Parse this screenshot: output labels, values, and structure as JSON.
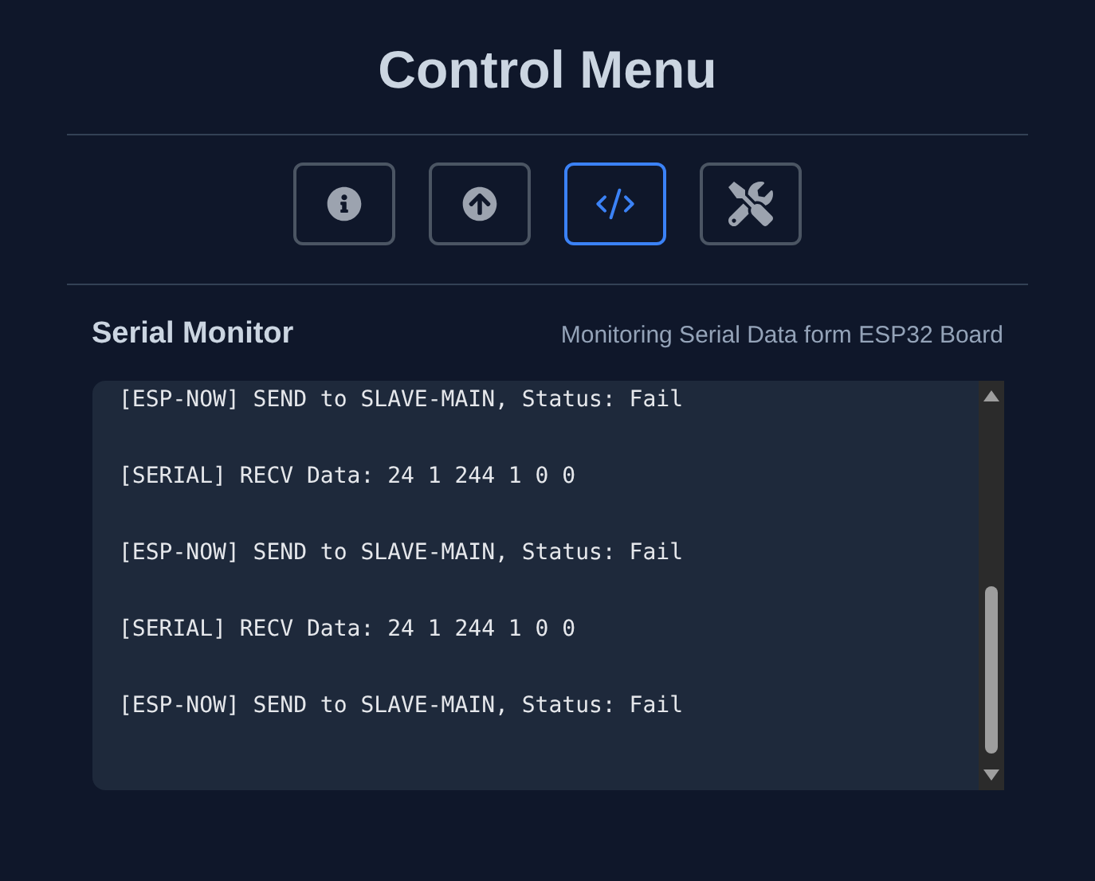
{
  "title": "Control Menu",
  "tabs": [
    {
      "kind": "info",
      "selected": false
    },
    {
      "kind": "upload",
      "selected": false
    },
    {
      "kind": "code",
      "selected": true
    },
    {
      "kind": "tools",
      "selected": false
    }
  ],
  "panel": {
    "title": "Serial Monitor",
    "subtitle": "Monitoring Serial Data form ESP32 Board",
    "log": [
      "[ESP-NOW] SEND to SLAVE-MAIN, Status: Fail",
      "[SERIAL] RECV Data: 24 1 244 1 0 0",
      "[ESP-NOW] SEND to SLAVE-MAIN, Status: Fail",
      "[SERIAL] RECV Data: 24 1 244 1 0 0",
      "[ESP-NOW] SEND to SLAVE-MAIN, Status: Fail"
    ]
  }
}
